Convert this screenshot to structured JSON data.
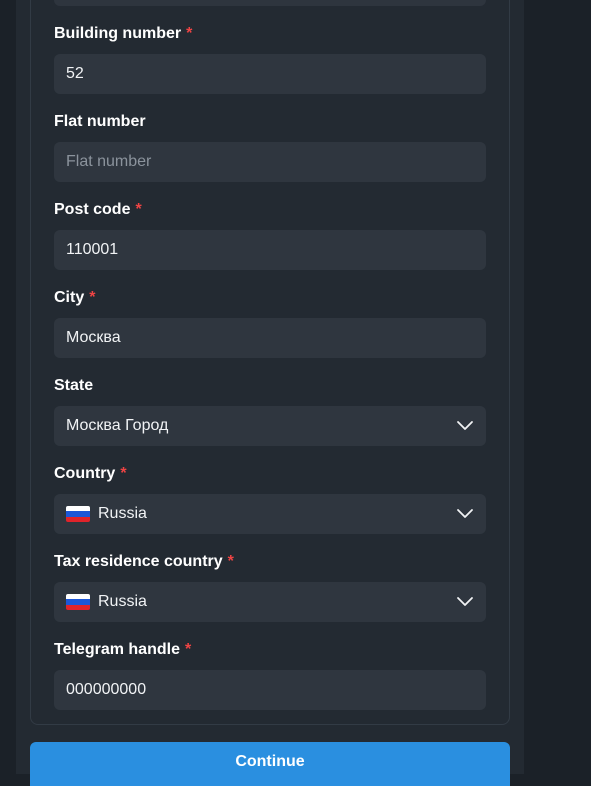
{
  "form": {
    "fields": [
      {
        "label": "Building number",
        "required": true,
        "value": "52"
      },
      {
        "label": "Flat number",
        "required": false,
        "value": "",
        "placeholder": "Flat number"
      },
      {
        "label": "Post code",
        "required": true,
        "value": "110001"
      },
      {
        "label": "City",
        "required": true,
        "value": "Москва"
      },
      {
        "label": "State",
        "required": false,
        "value": "Москва Город"
      },
      {
        "label": "Country",
        "required": true,
        "value": "Russia"
      },
      {
        "label": "Tax residence country",
        "required": true,
        "value": "Russia"
      },
      {
        "label": "Telegram handle",
        "required": true,
        "value": "000000000"
      }
    ],
    "required_mark": "*",
    "continue_label": "Continue"
  },
  "colors": {
    "accent": "#2a8fe0",
    "required": "#ef4444",
    "flag_ru": [
      "#ffffff",
      "#1c57d8",
      "#e0232a"
    ]
  },
  "icons": {
    "dropdown": "chevron-down-icon",
    "flag": "russia-flag-icon"
  }
}
